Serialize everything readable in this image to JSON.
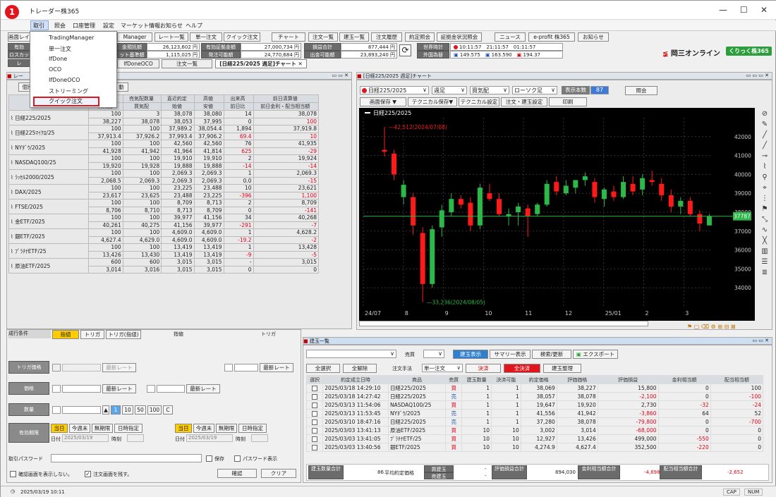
{
  "app": {
    "title": "トレーダー株365",
    "callout": "1"
  },
  "menu": [
    "取引",
    "照会",
    "口座管理",
    "設定",
    "マーケット情報",
    "お知らせ",
    "ヘルプ"
  ],
  "dropdown": [
    "TradingManager",
    "単一注文",
    "IfDone",
    "OCO",
    "IfDoneOCO",
    "ストリーミング",
    "クイック注文"
  ],
  "toolbar": [
    "Manager",
    "レート一覧",
    "単一注文",
    "クイック注文",
    "チャート",
    "注文一覧",
    "建玉一覧",
    "注文履歴",
    "約定照会",
    "証拠金状況照会",
    "ニュース",
    "e-profit 株365",
    "お知らせ"
  ],
  "account": {
    "row1": [
      [
        "金預託額",
        "26,123,602 円"
      ],
      [
        "有効証拠金額",
        "27,000,734 円"
      ],
      [
        "損益合計",
        "877,444 円"
      ]
    ],
    "row2": [
      [
        "ット基準額",
        "1,115,025 円"
      ],
      [
        "発注可能額",
        "24,770,684 円"
      ],
      [
        "出金可能額",
        "23,893,240 円"
      ]
    ]
  },
  "clock": {
    "label1": "世界時計",
    "label2": "外国為替",
    "t1": "10:11:57",
    "t2": "21:11:57",
    "t3": "01:11:57",
    "fx1": "149.575",
    "fx2": "163.590",
    "fx3": "194.37"
  },
  "brand": "岡三オンライン",
  "brand_badge": "くりっく株365",
  "tabs": [
    "lfDoneOCO",
    "注文一覧",
    "[日経225/2025 週足]チャート"
  ],
  "left_labels": [
    "画面レイ",
    "有効",
    "ロスカッ",
    "レ"
  ],
  "rate_panel": {
    "title": "レー",
    "buttons": [
      "個別",
      "動"
    ],
    "headers": [
      "売気配",
      "売気配数量",
      "直近約定",
      "高値",
      "出来高",
      "前日清算値"
    ],
    "subheaders": [
      "買気配",
      "買気配",
      "始値",
      "安値",
      "前日比",
      "前日金利・配当相当額"
    ],
    "rows": [
      {
        "name": "日経225/2025",
        "r1": [
          "100",
          "3",
          "38,078",
          "38,080",
          "14",
          "38,078"
        ],
        "r2": [
          "38,227",
          "38,078",
          "38,053",
          "37,995",
          "0",
          "100"
        ],
        "neg": [
          5
        ]
      },
      {
        "name": "日経225ﾏｲｸﾛ/25",
        "r1": [
          "100",
          "100",
          "37,989.2",
          "38,054.4",
          "1,894",
          "37,919.8"
        ],
        "r2": [
          "37,913.4",
          "37,926.2",
          "37,993.4",
          "37,906.2",
          "69.4",
          "10"
        ],
        "neg": [
          4,
          5
        ]
      },
      {
        "name": "NYﾀﾞｳ/2025",
        "r1": [
          "100",
          "100",
          "42,560",
          "42,560",
          "76",
          "41,935"
        ],
        "r2": [
          "41,928",
          "41,942",
          "41,964",
          "41,814",
          "625",
          "-29"
        ],
        "neg": [
          4,
          5
        ]
      },
      {
        "name": "NASDAQ100/25",
        "r1": [
          "100",
          "100",
          "19,910",
          "19,910",
          "2",
          "19,924"
        ],
        "r2": [
          "19,920",
          "19,928",
          "19,888",
          "19,888",
          "-14",
          "-14"
        ],
        "neg": [
          4,
          5
        ]
      },
      {
        "name": "ﾗｯｾﾙ2000/2025",
        "r1": [
          "100",
          "100",
          "2,069.3",
          "2,069.3",
          "1",
          "2,069.3"
        ],
        "r2": [
          "2,068.5",
          "2,069.3",
          "2,069.3",
          "2,069.3",
          "0.0",
          "-15"
        ],
        "neg": [
          5
        ]
      },
      {
        "name": "DAX/2025",
        "r1": [
          "100",
          "100",
          "23,225",
          "23,488",
          "10",
          "23,621"
        ],
        "r2": [
          "23,617",
          "23,625",
          "23,488",
          "23,225",
          "-396",
          "1,100"
        ],
        "neg": [
          4,
          5
        ]
      },
      {
        "name": "FTSE/2025",
        "r1": [
          "100",
          "100",
          "8,709",
          "8,713",
          "2",
          "8,709"
        ],
        "r2": [
          "8,706",
          "8,710",
          "8,713",
          "8,709",
          "0",
          "-141"
        ],
        "neg": [
          5
        ]
      },
      {
        "name": "金ETF/2025",
        "r1": [
          "100",
          "100",
          "39,977",
          "41,156",
          "34",
          "40,268"
        ],
        "r2": [
          "40,261",
          "40,275",
          "41,156",
          "39,977",
          "-291",
          "-7"
        ],
        "neg": [
          4,
          5
        ]
      },
      {
        "name": "銀ETF/2025",
        "r1": [
          "100",
          "100",
          "4,609.0",
          "4,609.0",
          "1",
          "4,628.2"
        ],
        "r2": [
          "4,627.4",
          "4,629.0",
          "4,609.0",
          "4,609.0",
          "-19.2",
          "-2"
        ],
        "neg": [
          4,
          5
        ]
      },
      {
        "name": "ﾌﾟﾗﾁﾅETF/25",
        "r1": [
          "100",
          "100",
          "13,419",
          "13,419",
          "1",
          "13,428"
        ],
        "r2": [
          "13,426",
          "13,430",
          "13,419",
          "13,419",
          "-9",
          "-5"
        ],
        "neg": [
          4,
          5
        ]
      },
      {
        "name": "原油ETF/2025",
        "r1": [
          "600",
          "600",
          "3,015",
          "3,015",
          "-",
          "3,015"
        ],
        "r2": [
          "3,014",
          "3,016",
          "3,015",
          "3,015",
          "0",
          "0"
        ],
        "neg": []
      }
    ]
  },
  "order_form": {
    "header": [
      "成行条件",
      "指値",
      "トリガ",
      "トリガ(指値)",
      "指値",
      "トリガ"
    ],
    "labels": [
      "トリガ価格",
      "価格",
      "数量",
      "有効期限",
      "取引パスワード"
    ],
    "latest": "最新レート",
    "qty_btns": [
      "1",
      "10",
      "50",
      "100",
      "C"
    ],
    "exp_btns": [
      "当日",
      "今週末",
      "無期限",
      "日時指定"
    ],
    "date_label": "日付",
    "date": "2025/03/19",
    "time_label": "時刻",
    "save": "保存",
    "pw_show": "パスワード表示",
    "no_confirm": "確認画面を表示しない。",
    "keep": "注文画面を残す。",
    "confirm": "確認",
    "clear": "クリア"
  },
  "chart": {
    "title": "[日経225/2025 週足]チャート",
    "symbol": "日経225/2025",
    "period": "週足",
    "side": "買気配",
    "type": "ローソク足",
    "count_label": "表示本数",
    "count": "87",
    "ref": "照会",
    "buttons": [
      "画面保存 ▼",
      "テクニカル保存▼",
      "テクニカル設定",
      "注文・建玉設定",
      "印刷"
    ],
    "legend": "日経225/2025",
    "high_label": "42,512(2024/07/08)",
    "low_label": "33,236(2024/08/05)",
    "price": "37787",
    "yticks": [
      "42000",
      "41000",
      "40000",
      "39000",
      "38000",
      "37000",
      "36000",
      "35000",
      "34000"
    ],
    "xticks": [
      "24/07",
      "8",
      "9",
      "10",
      "11",
      "12",
      "25/01",
      "2",
      "3"
    ]
  },
  "chart_data": {
    "type": "candlestick",
    "ylim": [
      33000,
      43000
    ],
    "candles": [
      [
        41300,
        42512,
        40950,
        41200
      ],
      [
        41100,
        41300,
        39700,
        40000
      ],
      [
        38800,
        39700,
        38400,
        39450
      ],
      [
        38800,
        39000,
        36800,
        37300
      ],
      [
        36900,
        37200,
        33236,
        34200
      ],
      [
        34200,
        37300,
        34000,
        37100
      ],
      [
        37200,
        38400,
        36700,
        38100
      ],
      [
        38000,
        39000,
        37800,
        38700
      ],
      [
        38700,
        38900,
        38200,
        38400
      ],
      [
        38500,
        38800,
        37000,
        37300
      ],
      [
        37300,
        39500,
        37100,
        39300
      ],
      [
        39000,
        39500,
        38600,
        38700
      ],
      [
        38700,
        39000,
        37800,
        37900
      ],
      [
        37800,
        38200,
        37300,
        37900
      ],
      [
        38000,
        38500,
        37300,
        38300
      ],
      [
        38200,
        38400,
        36700,
        37800
      ],
      [
        37900,
        38500,
        37800,
        38400
      ],
      [
        38400,
        39700,
        38300,
        39500
      ],
      [
        39600,
        39900,
        38900,
        39100
      ],
      [
        39000,
        39700,
        38900,
        39400
      ],
      [
        39300,
        39700,
        39000,
        39700
      ],
      [
        39700,
        40100,
        39400,
        39900
      ],
      [
        39600,
        39800,
        38500,
        38800
      ],
      [
        38700,
        39300,
        38300,
        39200
      ],
      [
        39100,
        39400,
        38600,
        38800
      ],
      [
        38800,
        39900,
        38700,
        39600
      ],
      [
        39500,
        39900,
        38900,
        39100
      ],
      [
        39200,
        40000,
        38900,
        39800
      ],
      [
        39700,
        40200,
        39400,
        39600
      ],
      [
        39500,
        39800,
        38600,
        38900
      ],
      [
        38900,
        39200,
        38000,
        38300
      ],
      [
        38300,
        38800,
        37900,
        38600
      ],
      [
        38600,
        38800,
        37800,
        37900
      ],
      [
        37900,
        38100,
        37000,
        37400
      ],
      [
        37300,
        37900,
        37300,
        37787
      ]
    ]
  },
  "positions": {
    "title": "建玉一覧",
    "filter": {
      "side": "売買",
      "show": "建玉表示",
      "summary": "サマリー表示",
      "search": "検索/更新",
      "export": "エクスポート"
    },
    "buttons": [
      "全選択",
      "全解除",
      "注文手法",
      "単一注文",
      "決済",
      "全決済",
      "建玉整理"
    ],
    "headers": [
      "選択",
      "約定成立日時",
      "商品",
      "売買",
      "建玉数量",
      "決済可能",
      "約定価格",
      "評価価格",
      "評価損益",
      "金利相当額",
      "配当相当額"
    ],
    "rows": [
      [
        "2025/03/18 14:29:10",
        "日経225/2025",
        "買",
        "1",
        "1",
        "38,069",
        "38,227",
        "15,800",
        "0",
        "100"
      ],
      [
        "2025/03/18 14:27:42",
        "日経225/2025",
        "売",
        "1",
        "1",
        "38,057",
        "38,078",
        "-2,100",
        "0",
        "-100"
      ],
      [
        "2025/03/13 11:54:06",
        "NASDAQ100/25",
        "買",
        "1",
        "1",
        "19,647",
        "19,920",
        "2,730",
        "-32",
        "-24"
      ],
      [
        "2025/03/13 11:53:45",
        "NYﾀﾞｳ/2025",
        "売",
        "1",
        "1",
        "41,556",
        "41,942",
        "-3,860",
        "64",
        "52"
      ],
      [
        "2025/03/10 18:47:16",
        "日経225/2025",
        "売",
        "1",
        "1",
        "37,280",
        "38,078",
        "-79,800",
        "0",
        "-700"
      ],
      [
        "2025/03/03 13:41:13",
        "原油ETF/2025",
        "買",
        "10",
        "10",
        "3,002",
        "3,014",
        "-68,000",
        "0",
        "0"
      ],
      [
        "2025/03/03 13:41:05",
        "ﾌﾟﾗﾁﾅETF/25",
        "買",
        "10",
        "10",
        "12,927",
        "13,426",
        "499,000",
        "-550",
        "0"
      ],
      [
        "2025/03/03 13:40:56",
        "銀ETF/2025",
        "買",
        "10",
        "10",
        "4,274.9",
        "4,627.4",
        "352,500",
        "-220",
        "0"
      ]
    ],
    "footer": {
      "qty_label": "建玉数量合計",
      "qty": "86",
      "avg_label": "平均約定価格",
      "buy": "買建玉",
      "sell": "売建玉",
      "dash": "-",
      "pl_label": "評価損益合計",
      "pl": "894,030",
      "int_label": "金利相当額合計",
      "int": "-4,698",
      "div_label": "配当相当額合計",
      "div": "-2,652"
    }
  },
  "status": {
    "time": "2025/03/19 10:11",
    "cap": "CAP",
    "num": "NUM"
  }
}
